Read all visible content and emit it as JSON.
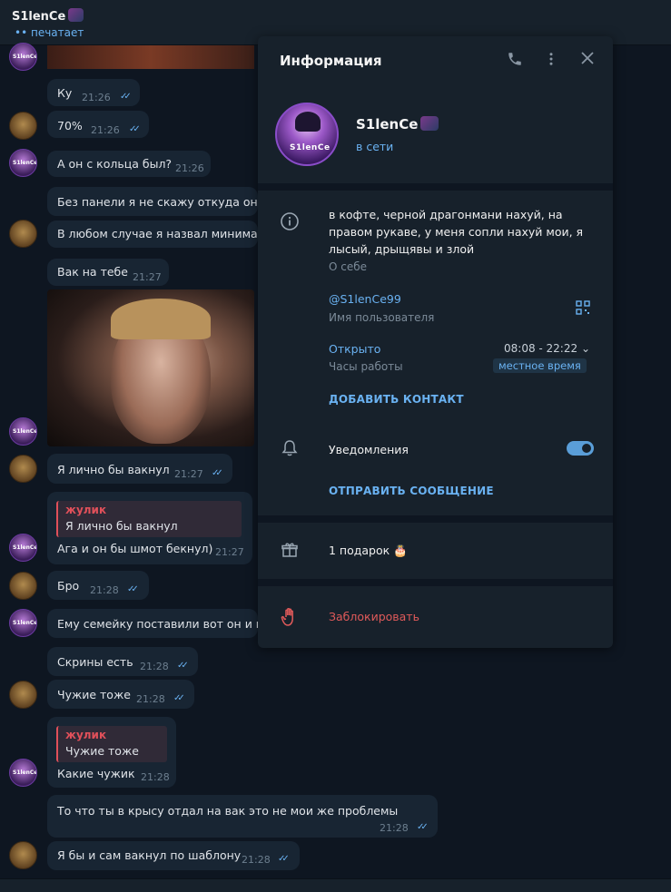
{
  "header": {
    "name": "S1lenCe",
    "status": "•• печатает"
  },
  "messages": [
    {
      "text": "Ку",
      "time": "21:26",
      "ticks": "✓✓"
    },
    {
      "text": "70%",
      "time": "21:26",
      "ticks": "✓✓"
    },
    {
      "text": "А он с кольца был?",
      "time": "21:26"
    },
    {
      "text": "Без панели я не скажу откуда он то"
    },
    {
      "text": "В любом случае я назвал минимальн"
    },
    {
      "text": "Вак на тебе",
      "time": "21:27"
    },
    {
      "text": "Я лично бы вакнул",
      "time": "21:27",
      "ticks": "✓✓"
    },
    {
      "reply_author": "жулик",
      "reply_quote": "Я лично бы вакнул",
      "text": "Ага и он бы шмот бекнул)",
      "time": "21:27"
    },
    {
      "text": "Бро",
      "time": "21:28",
      "ticks": "✓✓"
    },
    {
      "text": "Ему семейку поставили вот он и не"
    },
    {
      "text": "Скрины есть",
      "time": "21:28",
      "ticks": "✓✓"
    },
    {
      "text": "Чужие тоже",
      "time": "21:28",
      "ticks": "✓✓"
    },
    {
      "reply_author": "жулик",
      "reply_quote": "Чужие тоже",
      "text": "Какие чужик",
      "time": "21:28"
    },
    {
      "text": "То что ты в крысу отдал на вак это не мои же проблемы",
      "time": "21:28",
      "ticks": "✓✓"
    },
    {
      "text": "Я бы и сам вакнул по шаблону",
      "time": "21:28",
      "ticks": "✓✓"
    }
  ],
  "avatar_text": "S1lenCe",
  "panel": {
    "title": "Информация",
    "name": "S1lenCe",
    "online": "в сети",
    "about": "в кофте, черной драгонмани нахуй, на правом рукаве, у меня сопли нахуй мои, я лысый, дрыщявы и злой",
    "about_label": "О себе",
    "username": "@S1lenCe99",
    "username_label": "Имя пользователя",
    "hours_status": "Открыто",
    "hours_label": "Часы работы",
    "hours": "08:08 - 22:22 ⌄",
    "timezone": "местное время",
    "add_contact": "ДОБАВИТЬ КОНТАКТ",
    "notifications": "Уведомления",
    "notifications_on": true,
    "send_message": "ОТПРАВИТЬ СООБЩЕНИЕ",
    "gifts": "1 подарок 🎂",
    "block": "Заблокировать"
  },
  "icons": {
    "info": "info-icon",
    "bell": "bell-icon",
    "gift": "gift-icon",
    "block": "hand-block-icon",
    "phone": "phone-icon",
    "more": "more-vertical-icon",
    "close": "close-icon",
    "qr": "qr-code-icon"
  },
  "colors": {
    "background": "#0e1621",
    "panel": "#17212b",
    "bubble": "#182533",
    "accent": "#6ab2f2",
    "danger": "#e05a5a",
    "reply": "#e0505a"
  }
}
